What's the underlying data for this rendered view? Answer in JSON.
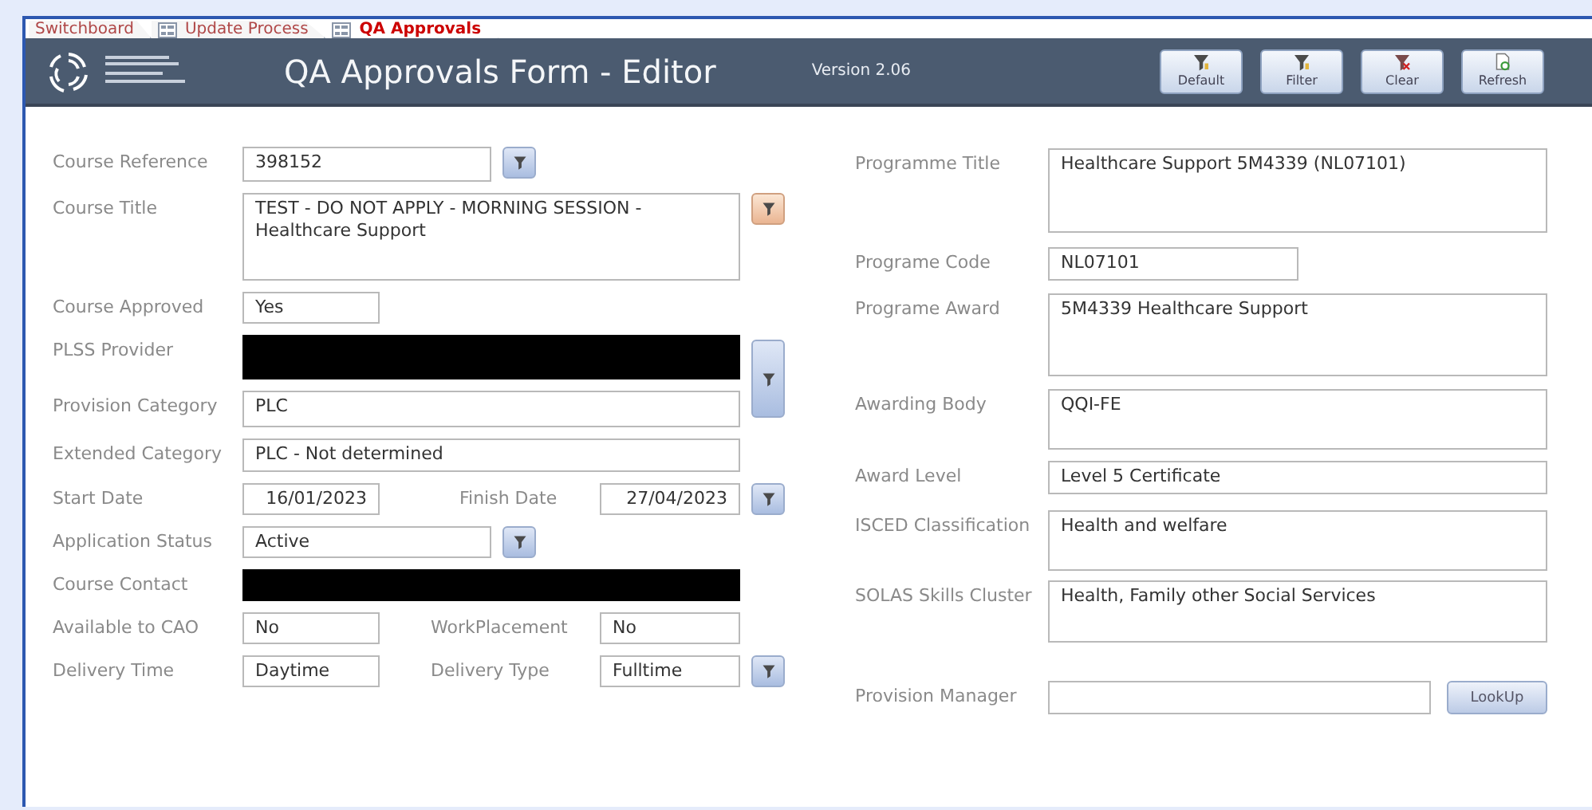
{
  "tabs": [
    {
      "label": "Switchboard",
      "selected": false
    },
    {
      "label": "Update Process",
      "selected": false
    },
    {
      "label": "QA Approvals",
      "selected": true
    }
  ],
  "header": {
    "title": "QA Approvals Form - Editor",
    "version": "Version 2.06",
    "buttons": [
      {
        "label": "Default",
        "kind": "filter"
      },
      {
        "label": "Filter",
        "kind": "filter"
      },
      {
        "label": "Clear",
        "kind": "clear"
      },
      {
        "label": "Refresh",
        "kind": "refresh"
      }
    ]
  },
  "left_rows": [
    {
      "fields": [
        {
          "label": "Course Reference",
          "value": "398152",
          "redacted": false
        }
      ],
      "filter": {
        "highlighted": false
      }
    },
    {
      "fields": [
        {
          "label": "Course Title",
          "value": "TEST - DO NOT APPLY - MORNING SESSION - Healthcare Support",
          "redacted": false
        }
      ],
      "filter": {
        "highlighted": true
      }
    },
    {
      "fields": [
        {
          "label": "Course Approved",
          "value": "Yes",
          "redacted": false
        }
      ]
    },
    {
      "fields": [
        {
          "label": "PLSS Provider",
          "redacted": true
        }
      ],
      "filter": {
        "highlighted": false
      }
    },
    {
      "fields": [
        {
          "label": "Provision Category",
          "value": "PLC",
          "redacted": false
        }
      ]
    },
    {
      "fields": [
        {
          "label": "Extended Category",
          "value": "PLC - Not determined",
          "redacted": false
        }
      ]
    },
    {
      "fields": [
        {
          "label": "Start Date",
          "value": "16/01/2023",
          "redacted": false
        },
        {
          "label": "Finish Date",
          "value": "27/04/2023",
          "redacted": false
        }
      ],
      "filter": {
        "highlighted": false
      }
    },
    {
      "fields": [
        {
          "label": "Application Status",
          "value": "Active",
          "redacted": false
        }
      ],
      "filter": {
        "highlighted": false
      }
    },
    {
      "fields": [
        {
          "label": "Course Contact",
          "redacted": true
        }
      ]
    },
    {
      "fields": [
        {
          "label": "Available to CAO",
          "value": "No",
          "redacted": false
        },
        {
          "label": "WorkPlacement",
          "value": "No",
          "redacted": false
        }
      ]
    },
    {
      "fields": [
        {
          "label": "Delivery Time",
          "value": "Daytime",
          "redacted": false
        },
        {
          "label": "Delivery Type",
          "value": "Fulltime",
          "redacted": false
        }
      ],
      "filter": {
        "highlighted": false
      }
    }
  ],
  "right_rows": [
    {
      "label": "Programme Title",
      "value": "Healthcare Support 5M4339 (NL07101)"
    },
    {
      "label": "Programe Code",
      "value": "NL07101"
    },
    {
      "label": "Programe Award",
      "value": "5M4339 Healthcare Support"
    },
    {
      "label": "Awarding Body",
      "value": "QQI-FE"
    },
    {
      "label": "Award Level",
      "value": "Level 5 Certificate"
    },
    {
      "label": "ISCED Classification",
      "value": "Health and welfare"
    },
    {
      "label": "SOLAS Skills Cluster",
      "value": "Health, Family other Social Services"
    },
    {
      "label": "Provision Manager",
      "button": "LookUp"
    }
  ]
}
